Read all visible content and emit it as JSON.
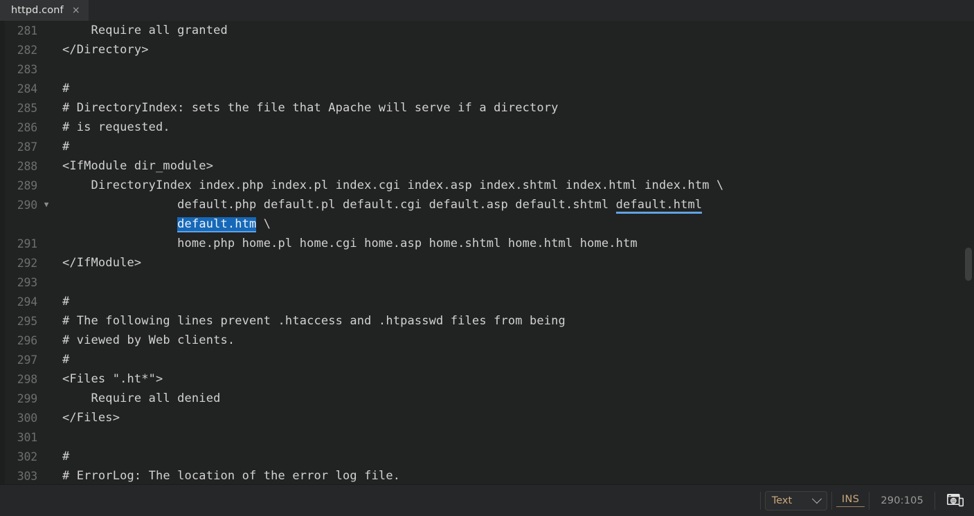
{
  "window": {
    "title": "httpd.conf",
    "background": "#212222",
    "accent": "#1668b8"
  },
  "tabbar": {
    "tabs": [
      {
        "label": "httpd.conf",
        "close_label": "×",
        "active": true
      }
    ]
  },
  "editor": {
    "first_line": 281,
    "lines": [
      {
        "no": "281",
        "text": "    Require all granted",
        "fold": ""
      },
      {
        "no": "282",
        "text": "</Directory>",
        "fold": ""
      },
      {
        "no": "283",
        "text": "",
        "fold": ""
      },
      {
        "no": "284",
        "text": "#",
        "fold": ""
      },
      {
        "no": "285",
        "text": "# DirectoryIndex: sets the file that Apache will serve if a directory",
        "fold": ""
      },
      {
        "no": "286",
        "text": "# is requested.",
        "fold": ""
      },
      {
        "no": "287",
        "text": "#",
        "fold": ""
      },
      {
        "no": "288",
        "text": "<IfModule dir_module>",
        "fold": ""
      },
      {
        "no": "289",
        "text": "    DirectoryIndex index.php index.pl index.cgi index.asp index.shtml index.html index.htm \\",
        "fold": ""
      },
      {
        "no": "290",
        "text": "",
        "fold": "▼",
        "wrapped": true
      },
      {
        "no": "",
        "text": "",
        "fold": "",
        "continuation": true
      },
      {
        "no": "291",
        "text": "                home.php home.pl home.cgi home.asp home.shtml home.html home.htm",
        "fold": ""
      },
      {
        "no": "292",
        "text": "</IfModule>",
        "fold": ""
      },
      {
        "no": "293",
        "text": "",
        "fold": ""
      },
      {
        "no": "294",
        "text": "#",
        "fold": ""
      },
      {
        "no": "295",
        "text": "# The following lines prevent .htaccess and .htpasswd files from being",
        "fold": ""
      },
      {
        "no": "296",
        "text": "# viewed by Web clients.",
        "fold": ""
      },
      {
        "no": "297",
        "text": "#",
        "fold": ""
      },
      {
        "no": "298",
        "text": "<Files \".ht*\">",
        "fold": ""
      },
      {
        "no": "299",
        "text": "    Require all denied",
        "fold": ""
      },
      {
        "no": "300",
        "text": "</Files>",
        "fold": ""
      },
      {
        "no": "301",
        "text": "",
        "fold": ""
      },
      {
        "no": "302",
        "text": "#",
        "fold": ""
      },
      {
        "no": "303",
        "text": "# ErrorLog: The location of the error log file.",
        "fold": ""
      }
    ],
    "line290": {
      "number": "290",
      "fold_glyph": "▼",
      "segment_a": "                default.php default.pl default.cgi default.asp default.shtml ",
      "occurrence": "default.html",
      "segment_b_indent": "                ",
      "selection": "default.htm",
      "segment_c": " \\"
    },
    "selection_color": "#1668b8",
    "occurrence_underline_color": "#63a2e4"
  },
  "scrollbar": {
    "orientation": "vertical",
    "thumb_name": "vertical-scroll-thumb"
  },
  "statusbar": {
    "syntax_label": "Text",
    "chevron_icon": "chevron-down-icon",
    "insert_mode": "INS",
    "cursor_position": "290:105",
    "preview_icon": "browser-device-preview-icon"
  }
}
